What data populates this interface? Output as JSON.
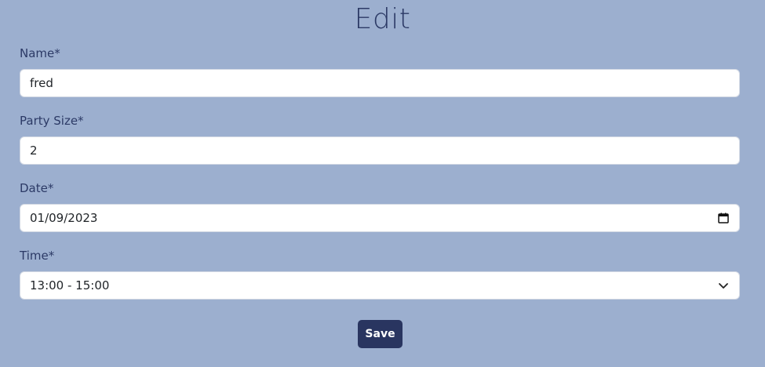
{
  "page": {
    "title": "Edit"
  },
  "form": {
    "name": {
      "label": "Name*",
      "value": "fred"
    },
    "party_size": {
      "label": "Party Size*",
      "value": "2"
    },
    "date": {
      "label": "Date*",
      "value": "01/09/2023",
      "icon": "calendar-icon"
    },
    "time": {
      "label": "Time*",
      "value": "13:00 - 15:00",
      "icon": "chevron-down-icon"
    },
    "save_label": "Save"
  },
  "colors": {
    "background": "#9cafcf",
    "text": "#2c3a66",
    "button": "#293560"
  }
}
